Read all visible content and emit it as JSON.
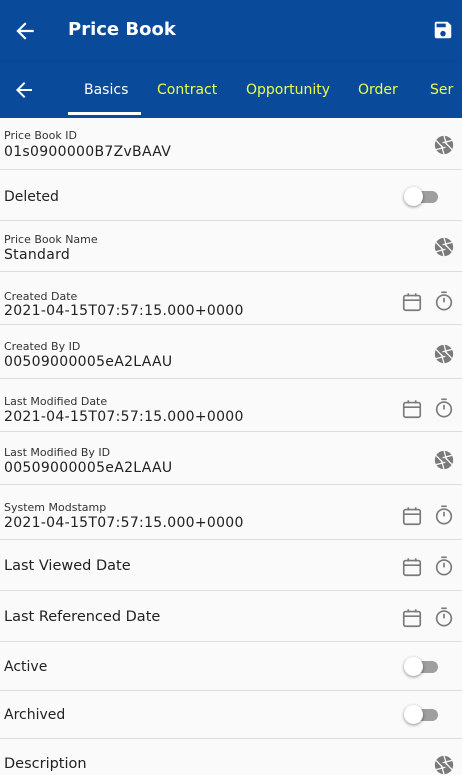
{
  "header": {
    "title": "Price Book"
  },
  "tabs": [
    {
      "label": "Basics"
    },
    {
      "label": "Contract"
    },
    {
      "label": "Opportunity"
    },
    {
      "label": "Order"
    },
    {
      "label": "Ser"
    }
  ],
  "fields": {
    "pricebook_id": {
      "label": "Price Book ID",
      "value": "01s0900000B7ZvBAAV"
    },
    "deleted": {
      "label": "Deleted",
      "on": false
    },
    "name": {
      "label": "Price Book Name",
      "value": "Standard"
    },
    "created_date": {
      "label": "Created Date",
      "value": "2021-04-15T07:57:15.000+0000"
    },
    "created_by": {
      "label": "Created By ID",
      "value": "00509000005eA2LAAU"
    },
    "last_modified_date": {
      "label": "Last Modified Date",
      "value": "2021-04-15T07:57:15.000+0000"
    },
    "last_modified_by": {
      "label": "Last Modified By ID",
      "value": "00509000005eA2LAAU"
    },
    "system_modstamp": {
      "label": "System Modstamp",
      "value": "2021-04-15T07:57:15.000+0000"
    },
    "last_viewed": {
      "label": "Last Viewed Date"
    },
    "last_referenced": {
      "label": "Last Referenced Date"
    },
    "active": {
      "label": "Active",
      "on": false
    },
    "archived": {
      "label": "Archived",
      "on": false
    },
    "description": {
      "label": "Description"
    }
  },
  "colors": {
    "primary": "#0a4a9a",
    "tab_text": "#e9ff4a",
    "active_tab": "#ffffff",
    "icon": "#7a7a7a"
  }
}
